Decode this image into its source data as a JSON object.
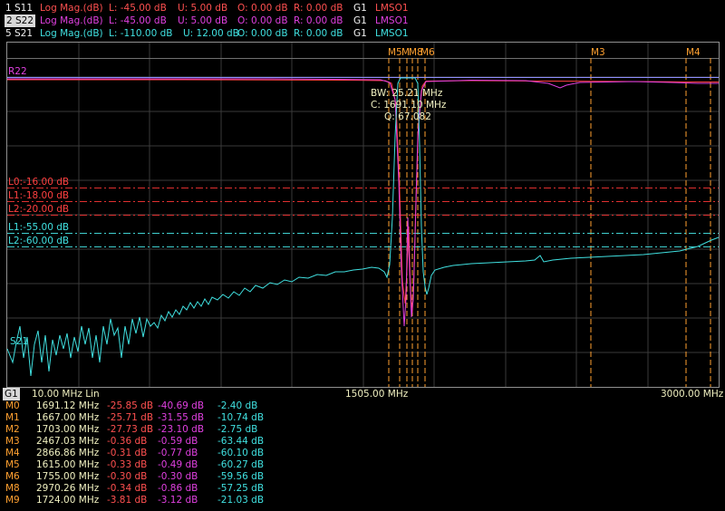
{
  "traces": [
    {
      "id": "1 S11",
      "format": "Log Mag.(dB)",
      "lower": "L: -45.00 dB",
      "upper": "U:  5.00 dB",
      "offset": "O:  0.00 dB",
      "ref": "R:  0.00 dB",
      "group": "G1",
      "fit": "LMSO1",
      "color": "#ff5050",
      "selected": false
    },
    {
      "id": "2 S22",
      "format": "Log Mag.(dB)",
      "lower": "L: -45.00 dB",
      "upper": "U:  5.00 dB",
      "offset": "O:  0.00 dB",
      "ref": "R:  0.00 dB",
      "group": "G1",
      "fit": "LMSO1",
      "color": "#e040e0",
      "selected": true
    },
    {
      "id": "5 S21",
      "format": "Log Mag.(dB)",
      "lower": "L: -110.00 dB",
      "upper": "U: 12.00 dB",
      "offset": "O:  0.00 dB",
      "ref": "R:  0.00 dB",
      "group": "G1",
      "fit": "LMSO1",
      "color": "#40e0e0",
      "selected": false
    }
  ],
  "plot": {
    "ref_label": "R22",
    "trace_label": "S21",
    "bw_lines": [
      "BW:  25.21 MHz",
      "C: 1691.10 MHz",
      "Q:  67.082"
    ],
    "limit_lines": [
      {
        "label": "L0:-16.00 dB",
        "color": "#ff4040"
      },
      {
        "label": "L1:-18.00 dB",
        "color": "#ff4040"
      },
      {
        "label": "L2:-20.00 dB",
        "color": "#ff4040"
      },
      {
        "label": "L1:-55.00 dB",
        "color": "#40e0e0"
      },
      {
        "label": "L2:-60.00 dB",
        "color": "#40e0e0"
      }
    ],
    "marker_tags": [
      "M5",
      "M",
      "M8",
      "M6",
      "M3",
      "M4"
    ]
  },
  "status": {
    "group": "G1",
    "start": "10.00 MHz Lin",
    "center": "1505.00 MHz",
    "stop": "3000.00 MHz"
  },
  "markers": [
    {
      "name": "M0",
      "freq": "1691.12 MHz",
      "s11": "-25.85 dB",
      "s22": "-40.69 dB",
      "s21": "-2.40 dB"
    },
    {
      "name": "M1",
      "freq": "1667.00 MHz",
      "s11": "-25.71 dB",
      "s22": "-31.55 dB",
      "s21": "-10.74 dB"
    },
    {
      "name": "M2",
      "freq": "1703.00 MHz",
      "s11": "-27.73 dB",
      "s22": "-23.10 dB",
      "s21": "-2.75 dB"
    },
    {
      "name": "M3",
      "freq": "2467.03 MHz",
      "s11": "-0.36 dB",
      "s22": "-0.59 dB",
      "s21": "-63.44 dB"
    },
    {
      "name": "M4",
      "freq": "2866.86 MHz",
      "s11": "-0.31 dB",
      "s22": "-0.77 dB",
      "s21": "-60.10 dB"
    },
    {
      "name": "M5",
      "freq": "1615.00 MHz",
      "s11": "-0.33 dB",
      "s22": "-0.49 dB",
      "s21": "-60.27 dB"
    },
    {
      "name": "M6",
      "freq": "1755.00 MHz",
      "s11": "-0.30 dB",
      "s22": "-0.30 dB",
      "s21": "-59.56 dB"
    },
    {
      "name": "M8",
      "freq": "2970.26 MHz",
      "s11": "-0.34 dB",
      "s22": "-0.86 dB",
      "s21": "-57.25 dB"
    },
    {
      "name": "M9",
      "freq": "1724.00 MHz",
      "s11": "-3.81 dB",
      "s22": "-3.12 dB",
      "s21": "-21.03 dB"
    }
  ],
  "colors": {
    "s11": "#ff5050",
    "s22": "#e040e0",
    "s21": "#40e0e0",
    "marker": "#ffa030",
    "grid": "#3a3a3a",
    "label": "#e0e040",
    "freq": "#f0f0c0"
  }
}
